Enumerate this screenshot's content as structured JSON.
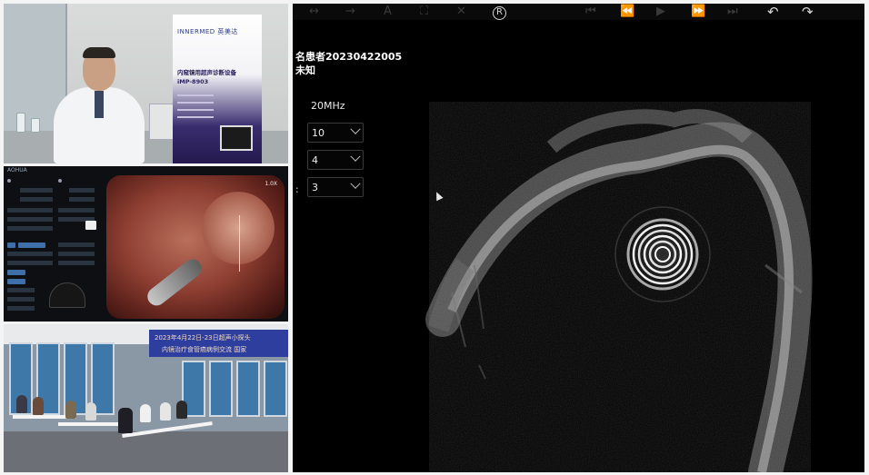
{
  "toolbar": {
    "icons": [
      "resize-horizontal-icon",
      "arrow-right-icon",
      "text-tool-icon",
      "fullscreen-icon",
      "close-icon",
      "registered-icon",
      "skip-start-icon",
      "rewind-icon",
      "play-icon",
      "fast-forward-icon",
      "skip-end-icon",
      "rotate-left-icon",
      "rotate-right-icon"
    ],
    "text_tool_label": "A",
    "registered_label": "R"
  },
  "patient": {
    "name_line": "名患者20230422005",
    "sex_line": "未知"
  },
  "settings": {
    "frequency": "20MHz",
    "select_1": "10",
    "select_2": "4",
    "select_3": "3",
    "colon": ":"
  },
  "doctor_feed": {
    "banner_logo": "INNERMED 英美达",
    "banner_line_1": "内窥镜用超声诊断设备",
    "banner_line_2": "iMP-8903"
  },
  "endoscope_feed": {
    "brand": "AOHUA",
    "mark": "1.0X"
  },
  "classroom_feed": {
    "screen_line_1": "2023年4月22日-23日超声小探头",
    "screen_line_2": "内镜治疗食管癌病例交流 国家"
  },
  "colors": {
    "background": "#f4f4f4",
    "ultrasound_bg": "#000000",
    "toolbar_dim": "#3a3a3a",
    "toolbar_lit": "#d8d8d8",
    "control_blue": "#3e6fa8"
  }
}
